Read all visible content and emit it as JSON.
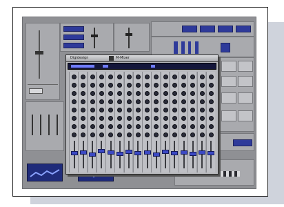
{
  "mixer_window": {
    "title_left": "Digidesign",
    "title_right": "M-Mixer",
    "icon": "mixer-icon",
    "channel_count": 16
  },
  "colors": {
    "screen_gray": "#8f9094",
    "panel_gray": "#a9aaae",
    "lcd_blue": "#1f2b7a",
    "fader_blue": "#3c49c4"
  }
}
